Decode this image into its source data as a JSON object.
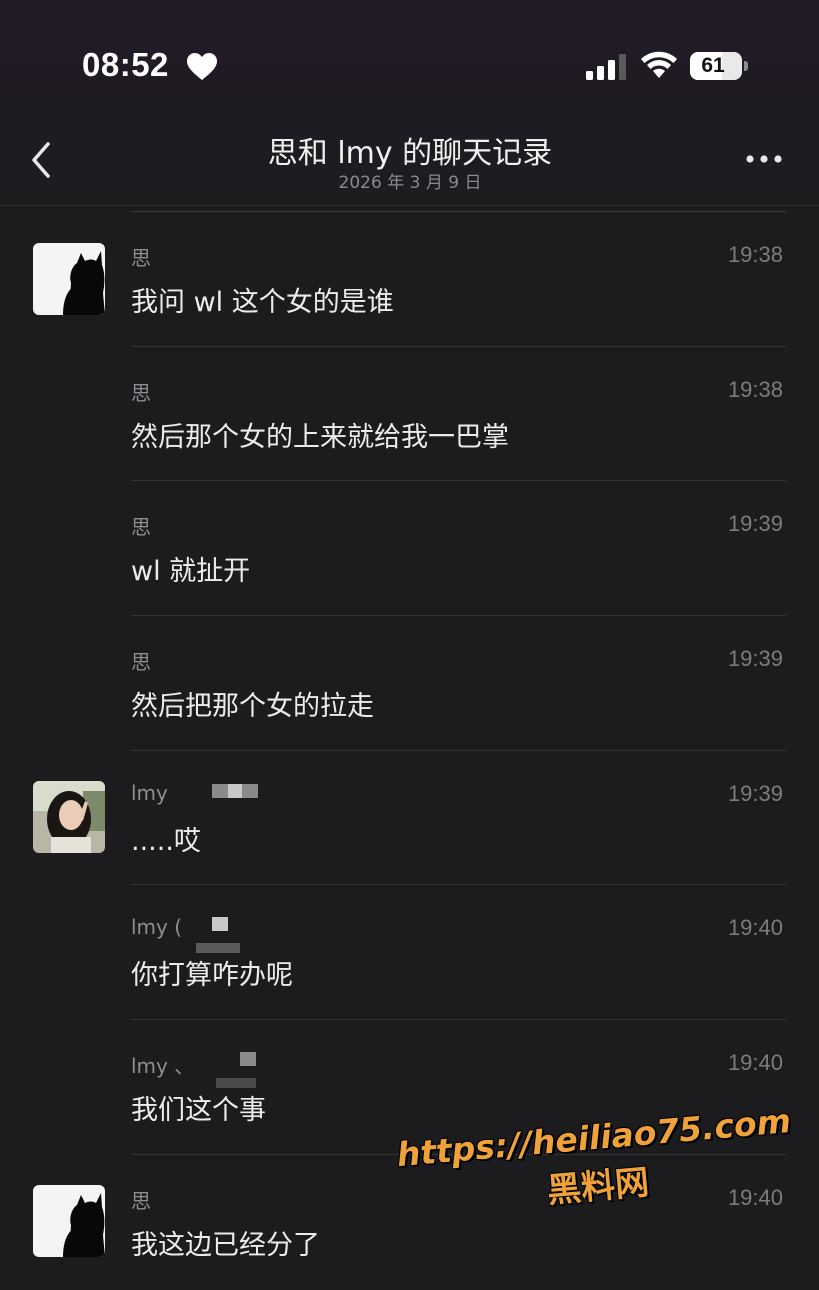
{
  "status_bar": {
    "time": "08:52",
    "battery": "61",
    "battery_level": 0.61
  },
  "header": {
    "title": "思和 lmy 的聊天记录",
    "date": "2026 年 3 月 9 日"
  },
  "messages": [
    {
      "sender": "思",
      "time": "19:38",
      "text": "我问 wl 这个女的是谁",
      "avatar": "black-cat-avatar"
    },
    {
      "sender": "思",
      "time": "19:38",
      "text": "然后那个女的上来就给我一巴掌"
    },
    {
      "sender": "思",
      "time": "19:39",
      "text": "wl 就扯开"
    },
    {
      "sender": "思",
      "time": "19:39",
      "text": "然后把那个女的拉走"
    },
    {
      "sender": "lmy",
      "time": "19:39",
      "text": ".....哎",
      "avatar": "girl-photo-avatar"
    },
    {
      "sender": "lmy (",
      "time": "19:40",
      "text": "你打算咋办呢"
    },
    {
      "sender": "lmy 、",
      "time": "19:40",
      "text": "我们这个事"
    },
    {
      "sender": "思",
      "time": "19:40",
      "text": "我这边已经分了",
      "avatar": "black-cat-avatar"
    }
  ],
  "watermark": {
    "url": "https://heiliao75.com",
    "name": "黑料网"
  },
  "colors": {
    "background": "#1c1c1e",
    "text": "#ececec",
    "muted": "#8e8e93",
    "watermark": "#f0a23a"
  }
}
